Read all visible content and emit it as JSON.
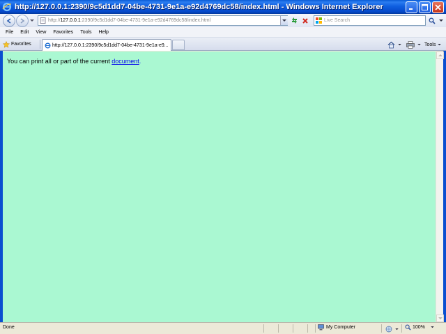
{
  "window": {
    "title": "http://127.0.0.1:2390/9c5d1dd7-04be-4731-9e1a-e92d4769dc58/index.html - Windows Internet Explorer"
  },
  "address_bar": {
    "prefix": "http://",
    "host": "127.0.0.1",
    "rest": ":2390/9c5d1dd7-04be-4731-9e1a-e92d4769dc58/index.html"
  },
  "search": {
    "placeholder": "Live Search"
  },
  "menu": {
    "items": [
      "File",
      "Edit",
      "View",
      "Favorites",
      "Tools",
      "Help"
    ]
  },
  "tabs": {
    "favorites_label": "Favorites",
    "active_tab_label": "http://127.0.0.1:2390/9c5d1dd7-04be-4731-9e1a-e9...",
    "tools_label": "Tools"
  },
  "page": {
    "text_before_link": "You can print all or part of the current ",
    "link_text": "document",
    "text_after_link": ".",
    "background_color": "#aaf8d2"
  },
  "status": {
    "text": "Done",
    "zone": "My Computer",
    "zoom": "100%"
  },
  "icons": {
    "ie": "ie-logo-icon",
    "back": "back-arrow-icon",
    "forward": "forward-arrow-icon",
    "refresh": "refresh-icon",
    "stop": "stop-icon",
    "search": "magnifier-icon",
    "favorites": "star-icon",
    "home": "home-icon",
    "print": "printer-icon",
    "computer": "computer-icon",
    "zoom": "zoom-magnifier-icon"
  }
}
